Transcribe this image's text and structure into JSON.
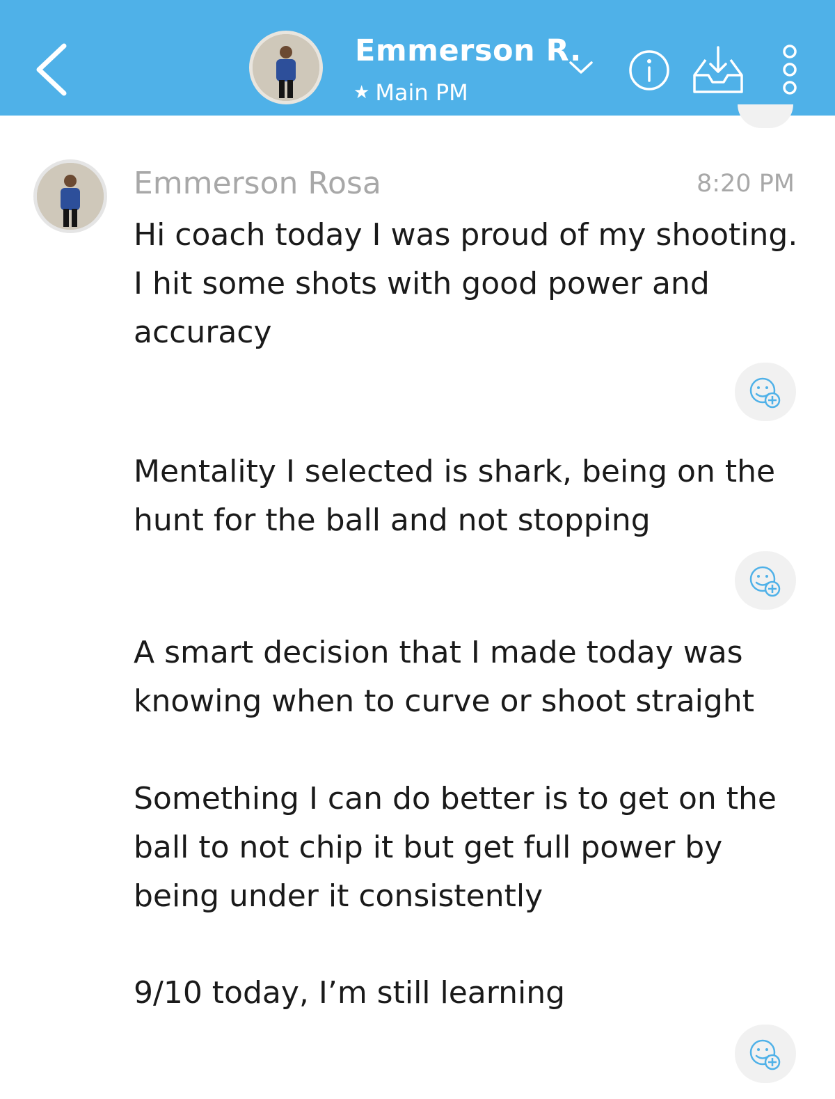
{
  "header": {
    "contact_name": "Emmerson R.",
    "subtitle": "Main PM",
    "background": "#4fb1e8",
    "icons": [
      "back-chevron-icon",
      "chevron-down-icon",
      "star-icon",
      "info-icon",
      "inbox-download-icon",
      "more-vertical-icon"
    ]
  },
  "message": {
    "sender": "Emmerson Rosa",
    "time": "8:20 PM",
    "parts": [
      "Hi coach today I was proud of my shooting. I hit some shots with good power and accuracy",
      "Mentality I selected is shark, being on the hunt for the ball and not stopping",
      "A smart decision that I made today was knowing when to curve or shoot straight",
      "Something I can do better is to get on the ball to not chip it but get full power by being under it consistently",
      "9/10 today, I’m still learning"
    ]
  },
  "reaction_icon": "add-reaction-icon"
}
